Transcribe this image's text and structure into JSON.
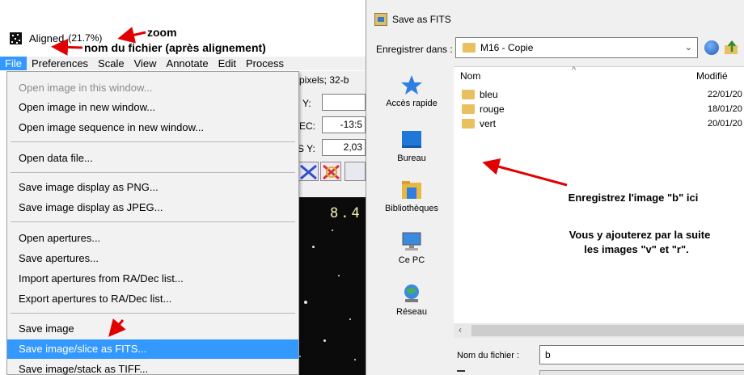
{
  "imagej": {
    "window_title": "Aligned",
    "zoom": "(21.7%)",
    "menubar": [
      "File",
      "Preferences",
      "Scale",
      "View",
      "Annotate",
      "Edit",
      "Process"
    ],
    "active_menu": "File",
    "behind": {
      "info": "pixels; 32-b",
      "fields": [
        {
          "label": "Y:",
          "value": ""
        },
        {
          "label": "EC:",
          "value": "-13:5"
        },
        {
          "label": "S Y:",
          "value": "2,03"
        }
      ],
      "image_coord": "8.4"
    },
    "file_menu": [
      {
        "label": "Open image in this window...",
        "enabled": false
      },
      {
        "label": "Open image in new window...",
        "enabled": true
      },
      {
        "label": "Open image sequence in new window...",
        "enabled": true
      },
      {
        "label": "Open data file...",
        "enabled": true
      },
      {
        "label": "Save image display as PNG...",
        "enabled": true
      },
      {
        "label": "Save image display as JPEG...",
        "enabled": true
      },
      {
        "label": "Open apertures...",
        "enabled": true
      },
      {
        "label": "Save apertures...",
        "enabled": true
      },
      {
        "label": "Import apertures from RA/Dec list...",
        "enabled": true
      },
      {
        "label": "Export apertures to RA/Dec list...",
        "enabled": true
      },
      {
        "label": "Save image",
        "enabled": true
      },
      {
        "label": "Save image/slice as FITS...",
        "enabled": true,
        "selected": true
      },
      {
        "label": "Save image/stack as TIFF...",
        "enabled": true
      }
    ],
    "annotations": {
      "zoom": "zoom",
      "file_name": "nom du fichier (après alignement)"
    }
  },
  "dialog": {
    "title": "Save as FITS",
    "save_in_label": "Enregistrer dans :",
    "save_in_value": "M16 - Copie",
    "places": [
      "Accès rapide",
      "Bureau",
      "Bibliothèques",
      "Ce PC",
      "Réseau"
    ],
    "columns": {
      "name": "Nom",
      "modified": "Modifié"
    },
    "files": [
      {
        "name": "bleu",
        "date": "22/01/20"
      },
      {
        "name": "rouge",
        "date": "18/01/20"
      },
      {
        "name": "vert",
        "date": "20/01/20"
      }
    ],
    "filename_label": "Nom du fichier :",
    "filename_value": "b",
    "annotations": {
      "line1": "Enregistrez l'image \"b\" ici",
      "line2": "Vous y ajouterez par la suite",
      "line3": "les images \"v\" et \"r\"."
    }
  },
  "colors": {
    "selection": "#3399ff",
    "arrow": "#e00000",
    "folder": "#e8c060"
  }
}
